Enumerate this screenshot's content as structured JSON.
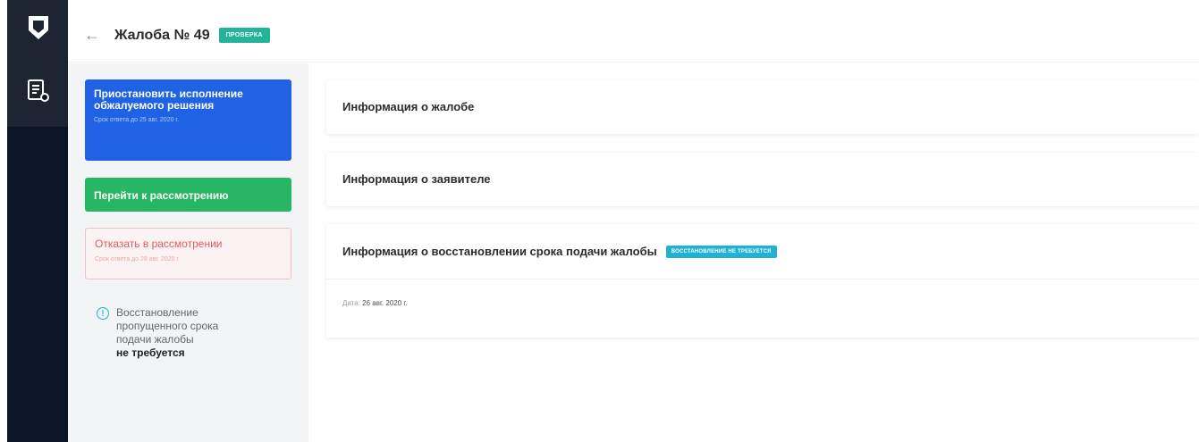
{
  "nav": {
    "back_arrow": "←",
    "page_title": "Жалоба № 49",
    "status_badge": "ПРОВЕРКА"
  },
  "actions": {
    "suspend": {
      "label": "Приостановить исполнение обжалуемого решения",
      "deadline": "Срок ответа до 25 авг. 2020 г."
    },
    "review": {
      "label": "Перейти к рассмотрению"
    },
    "refuse": {
      "label": "Отказать в рассмотрении",
      "deadline": "Срок ответа до 28 авг. 2020 г."
    }
  },
  "notice": {
    "icon": "info-icon",
    "text": "Восстановление пропущенного срока подачи жалобы",
    "emphasis": "не требуется"
  },
  "sections": {
    "complaint_info": "Информация о жалобе",
    "applicant_info": "Информация о заявителе",
    "restore_info": {
      "title": "Информация о восстановлении срока подачи жалобы",
      "badge": "ВОССТАНОВЛЕНИЕ НЕ ТРЕБУЕТСЯ",
      "date_label": "Дата",
      "date_value": "26 авг. 2020 г."
    }
  },
  "colors": {
    "rail": "#0b1526",
    "primary": "#1f62e6",
    "success": "#27b764",
    "danger": "#e55b5b",
    "status": "#23b59a",
    "info": "#1eb3d4"
  }
}
